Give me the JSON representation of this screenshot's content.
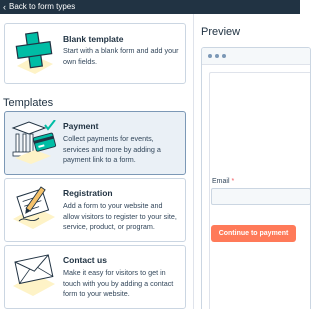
{
  "nav": {
    "back_label": "Back to form types"
  },
  "blank": {
    "title": "Blank template",
    "description": "Start with a blank form and add your own fields."
  },
  "templates_heading": "Templates",
  "templates": [
    {
      "title": "Payment",
      "description": "Collect payments for events, services and more by adding a payment link to a form.",
      "icon": "payment-icon",
      "selected": true
    },
    {
      "title": "Registration",
      "description": "Add a form to your website and allow visitors to register to your site, service, product, or program.",
      "icon": "registration-icon",
      "selected": false
    },
    {
      "title": "Contact us",
      "description": "Make it easy for visitors to get in touch with you by adding a contact form to your website.",
      "icon": "envelope-icon",
      "selected": false
    }
  ],
  "preview": {
    "title": "Preview",
    "email_label": "Email",
    "required_mark": "*",
    "cta_label": "Continue to payment"
  },
  "colors": {
    "topbar": "#213343",
    "accent_teal": "#00bda5",
    "cta": "#ff7a59",
    "selected_card": "#eaf0f6"
  }
}
